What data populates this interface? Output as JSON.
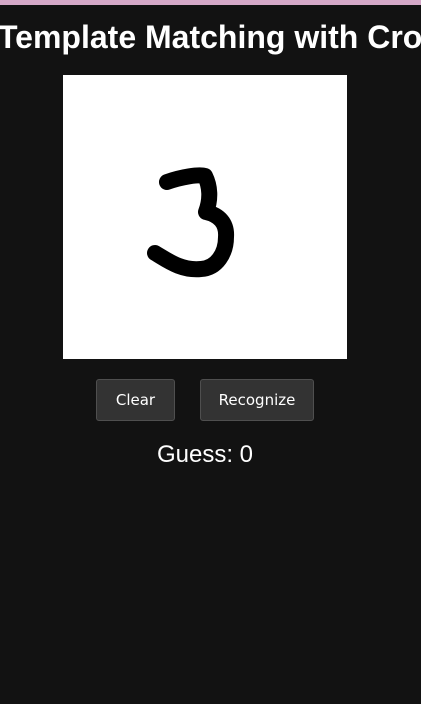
{
  "app": {
    "title": "Template Matching with Cro"
  },
  "drawing_canvas": {
    "content_icon": "handwritten-digit-3"
  },
  "controls": {
    "clear_label": "Clear",
    "recognize_label": "Recognize"
  },
  "result": {
    "guess_text": "Guess: 0"
  },
  "colors": {
    "background": "#121212",
    "top_strip": "#d4a8c8",
    "button_bg": "#333333",
    "canvas_bg": "#ffffff",
    "stroke": "#000000"
  }
}
